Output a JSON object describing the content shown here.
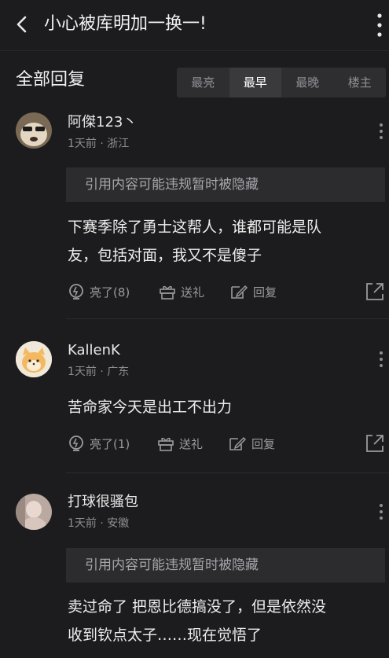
{
  "topbar": {
    "title": "小心被库明加一换一!"
  },
  "header": {
    "title": "全部回复",
    "sort_tabs": [
      "最亮",
      "最早",
      "最晚",
      "楼主"
    ],
    "active_sort": "最早"
  },
  "comments": [
    {
      "username": "阿傑123丶",
      "meta": "1天前 · 浙江",
      "quote": "引用内容可能违规暂时被隐藏",
      "content_lines": [
        "下赛季除了勇士这帮人，谁都可能是队",
        "友，包括对面，我又不是傻子"
      ],
      "like_label": "亮了(8)",
      "gift_label": "送礼",
      "reply_label": "回复"
    },
    {
      "username": "KallenK",
      "meta": "1天前 · 广东",
      "content_lines": [
        "苦命家今天是出工不出力"
      ],
      "like_label": "亮了(1)",
      "gift_label": "送礼",
      "reply_label": "回复"
    },
    {
      "username": "打球很骚包",
      "meta": "1天前 · 安徽",
      "quote": "引用内容可能违规暂时被隐藏",
      "content_lines": [
        "卖过命了 把恩比德搞没了，但是依然没",
        "收到钦点太子……现在觉悟了"
      ]
    }
  ],
  "colors": {
    "background": "#1c1c1e",
    "text": "#ededed",
    "muted": "#8d8d92",
    "quote_bg": "#2c2c2f"
  }
}
